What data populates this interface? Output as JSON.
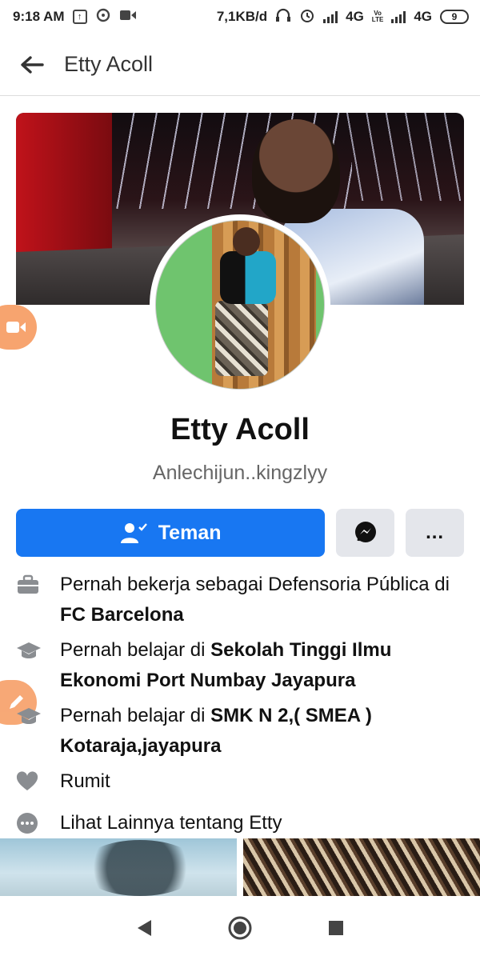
{
  "status_bar": {
    "time": "9:18 AM",
    "net_speed": "7,1KB/d",
    "network_1": "4G",
    "volte_1": "Vo",
    "volte_2": "LTE",
    "network_2": "4G",
    "battery": "9"
  },
  "header": {
    "title": "Etty Acoll",
    "back_icon": "arrow-left-icon"
  },
  "profile": {
    "name": "Etty Acoll",
    "nickname": "Anlechijun..kingzlyy"
  },
  "actions": {
    "friend_label": "Teman",
    "more_label": "..."
  },
  "about": {
    "work_prefix": "Pernah bekerja sebagai  Defensoria Pública di ",
    "work_place": "FC Barcelona",
    "edu1_prefix": "Pernah belajar di ",
    "edu1_place": "Sekolah Tinggi Ilmu Ekonomi Port Numbay Jayapura",
    "edu2_prefix": "Pernah belajar di ",
    "edu2_place": "SMK N 2,( SMEA ) Kotaraja,jayapura",
    "relationship": "Rumit",
    "see_more": "Lihat Lainnya tentang Etty"
  },
  "colors": {
    "accent": "#1877f2",
    "grey_button": "#e4e6eb",
    "floating_pill": "#f7a46f"
  }
}
